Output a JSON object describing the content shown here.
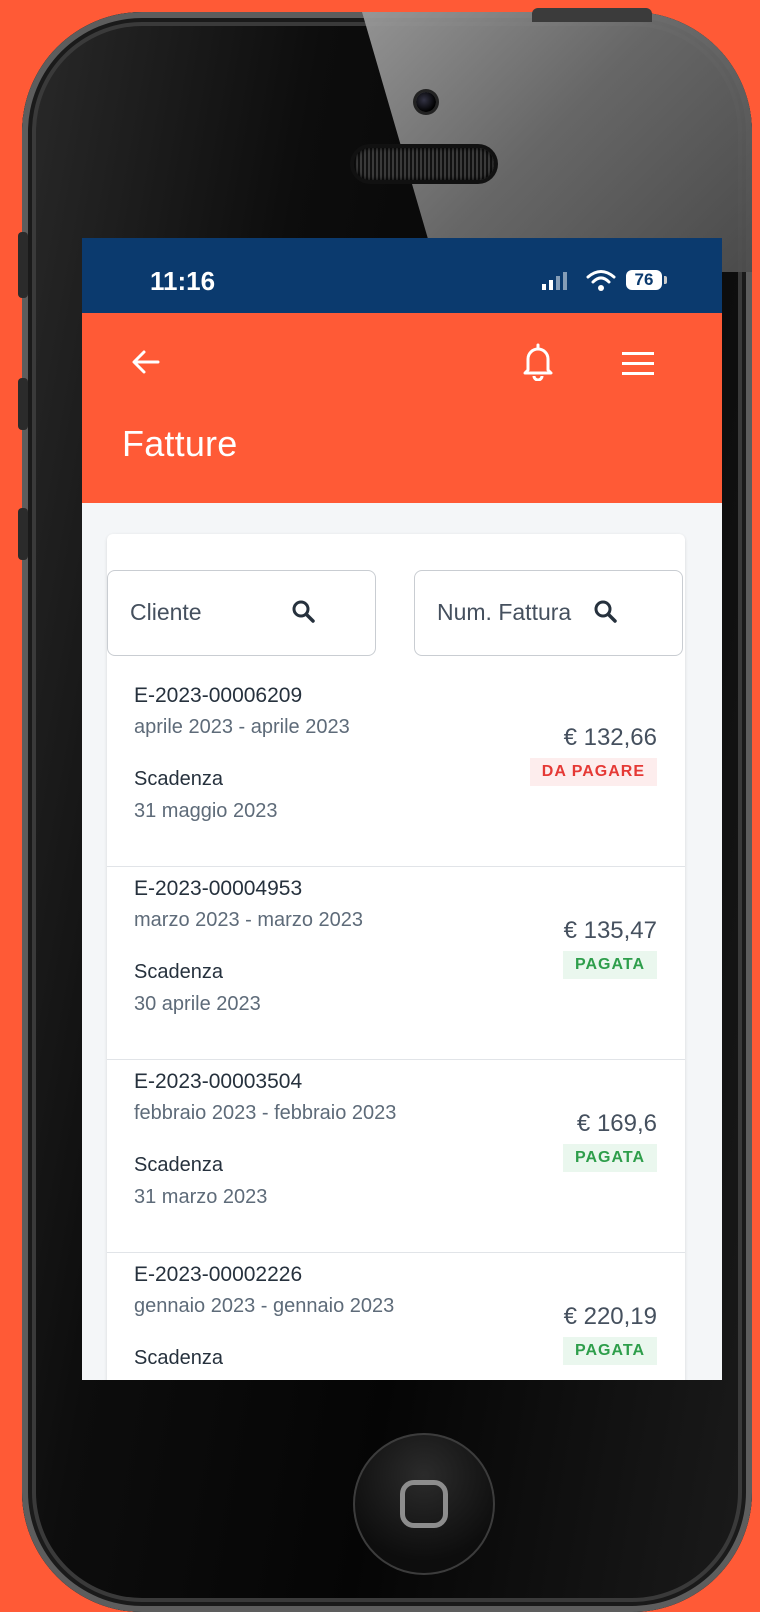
{
  "status_bar": {
    "time": "11:16",
    "battery": "76"
  },
  "header": {
    "title": "Fatture"
  },
  "search": {
    "client_placeholder": "Cliente",
    "invoice_placeholder": "Num. Fattura"
  },
  "invoices": [
    {
      "code": "E-2023-00006209",
      "period": "aprile 2023 - aprile 2023",
      "due_label": "Scadenza",
      "due_date": "31 maggio 2023",
      "amount": "€ 132,66",
      "status": "DA PAGARE"
    },
    {
      "code": "E-2023-00004953",
      "period": "marzo 2023 - marzo 2023",
      "due_label": "Scadenza",
      "due_date": "30 aprile 2023",
      "amount": "€ 135,47",
      "status": "PAGATA"
    },
    {
      "code": "E-2023-00003504",
      "period": "febbraio 2023 - febbraio 2023",
      "due_label": "Scadenza",
      "due_date": "31 marzo 2023",
      "amount": "€ 169,6",
      "status": "PAGATA"
    },
    {
      "code": "E-2023-00002226",
      "period": "gennaio 2023 - gennaio 2023",
      "due_label": "Scadenza",
      "due_date": "",
      "amount": "€ 220,19",
      "status": "PAGATA"
    }
  ],
  "colors": {
    "brand": "#FF5A36",
    "status_bar": "#0B3A6E",
    "unpaid": "#E53935",
    "paid": "#2E9E4B"
  },
  "icons": [
    "back-arrow-icon",
    "bell-icon",
    "hamburger-menu-icon",
    "search-icon",
    "signal-icon",
    "wifi-icon"
  ]
}
